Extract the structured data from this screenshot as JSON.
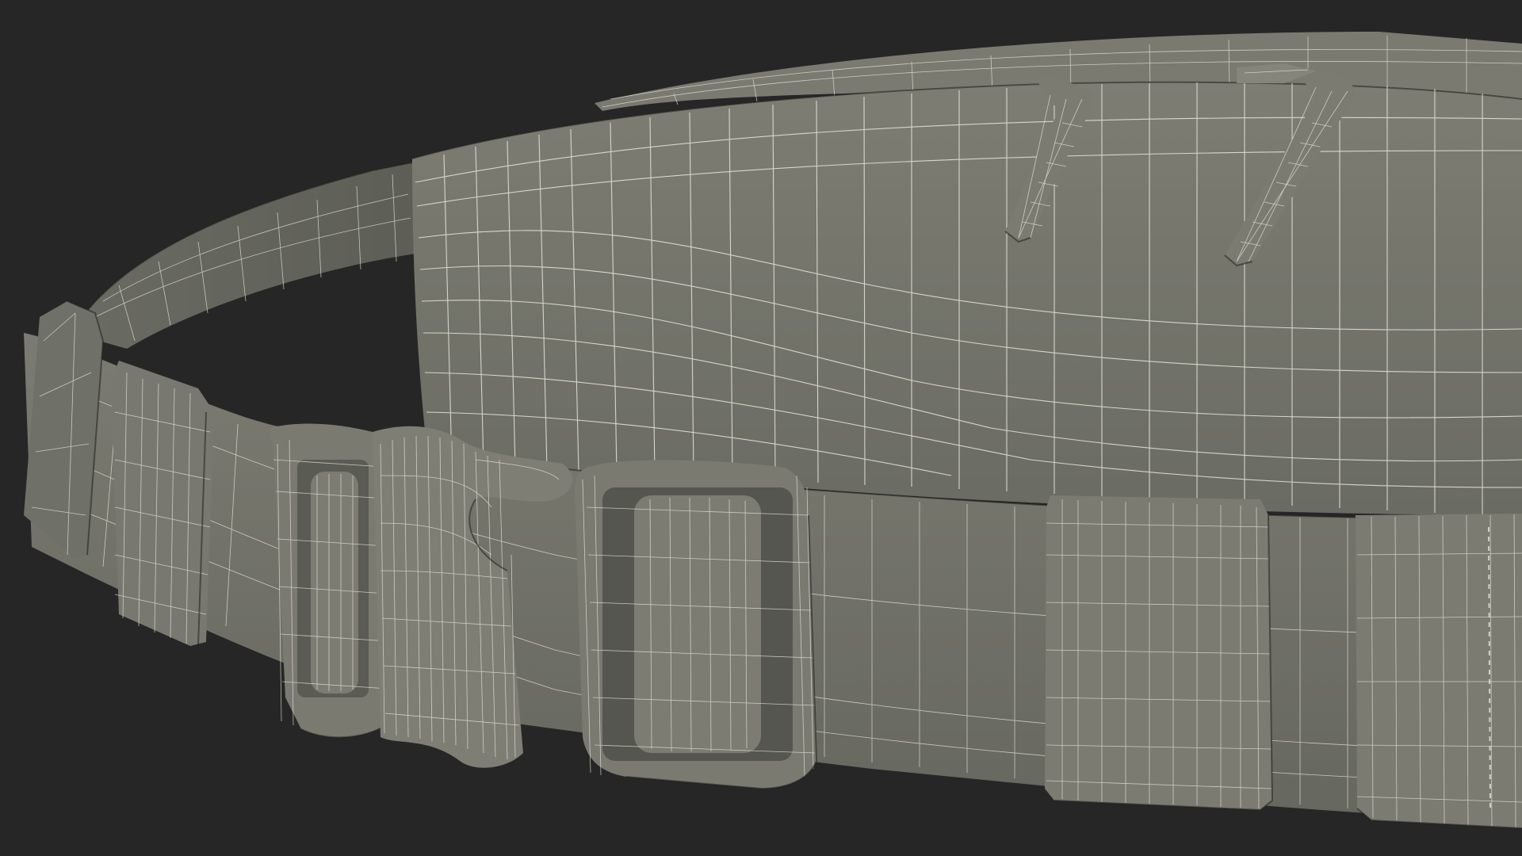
{
  "scene": {
    "subject": "",
    "colors": {
      "background": "#262626",
      "body": "#73736a",
      "body_light": "#85857b",
      "body_dark": "#5e5f57",
      "wire": "#e9e7dc"
    }
  }
}
